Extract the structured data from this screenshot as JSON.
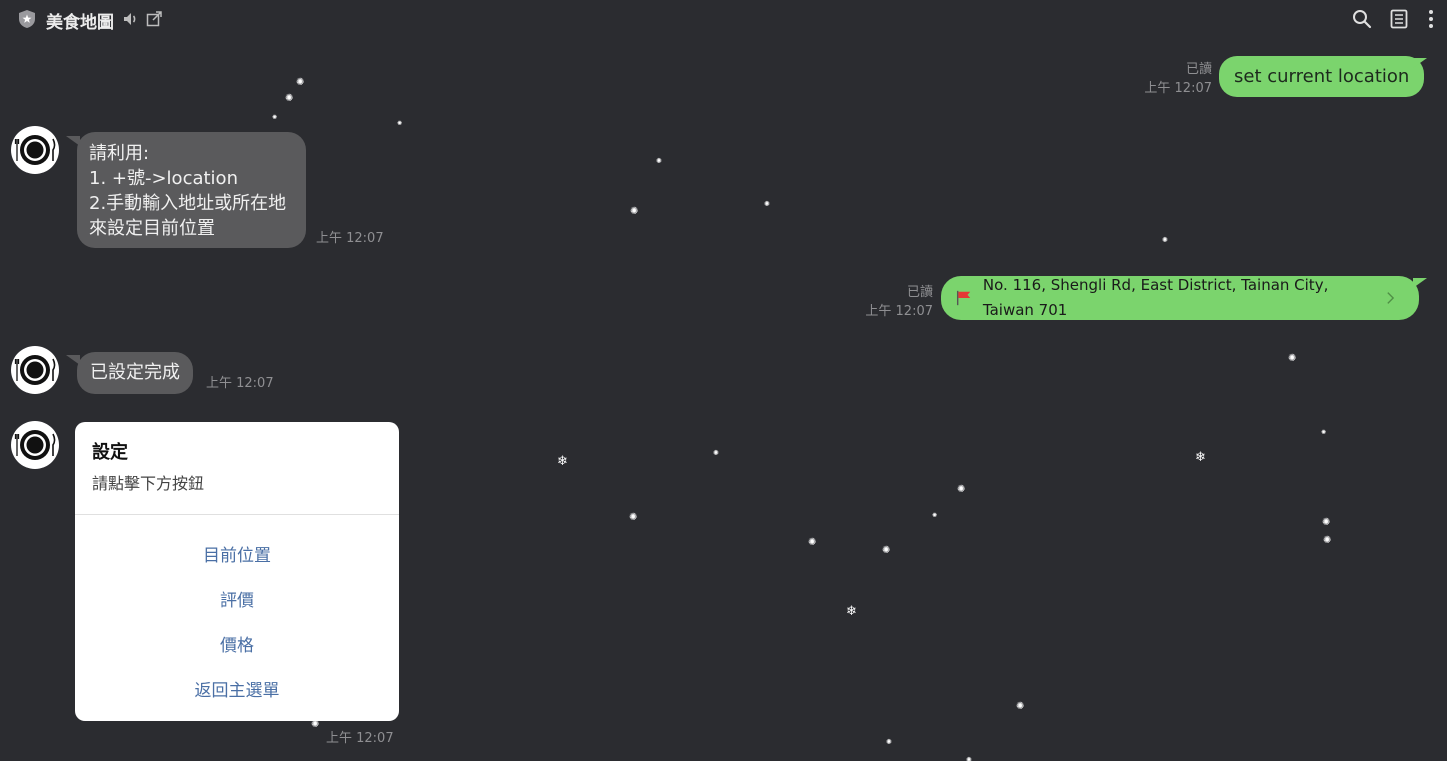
{
  "header": {
    "title": "美食地圖",
    "icons": [
      "shield-icon",
      "speaker-icon",
      "popout-icon",
      "search-icon",
      "notes-icon",
      "more-icon"
    ]
  },
  "colors": {
    "background": "#2b2c30",
    "bot_bubble": "#5a5a5c",
    "user_bubble": "#7bd46d",
    "card_button": "#4a6fa5"
  },
  "messages": [
    {
      "from": "user",
      "text": "set current location",
      "read": "已讀",
      "time": "上午 12:07"
    },
    {
      "from": "bot",
      "lines": [
        "請利用:",
        "1. +號->location",
        "2.手動輸入地址或所在地",
        "來設定目前位置"
      ],
      "time": "上午 12:07"
    },
    {
      "from": "user",
      "type": "location",
      "address": "No. 116, Shengli Rd, East District, Tainan City, Taiwan 701",
      "read": "已讀",
      "time": "上午 12:07"
    },
    {
      "from": "bot",
      "text": "已設定完成",
      "time": "上午 12:07"
    },
    {
      "from": "bot",
      "type": "card",
      "card": {
        "title": "設定",
        "subtitle": "請點擊下方按鈕",
        "buttons": [
          "目前位置",
          "評價",
          "價格",
          "返回主選單"
        ]
      },
      "time": "上午 12:07"
    }
  ]
}
